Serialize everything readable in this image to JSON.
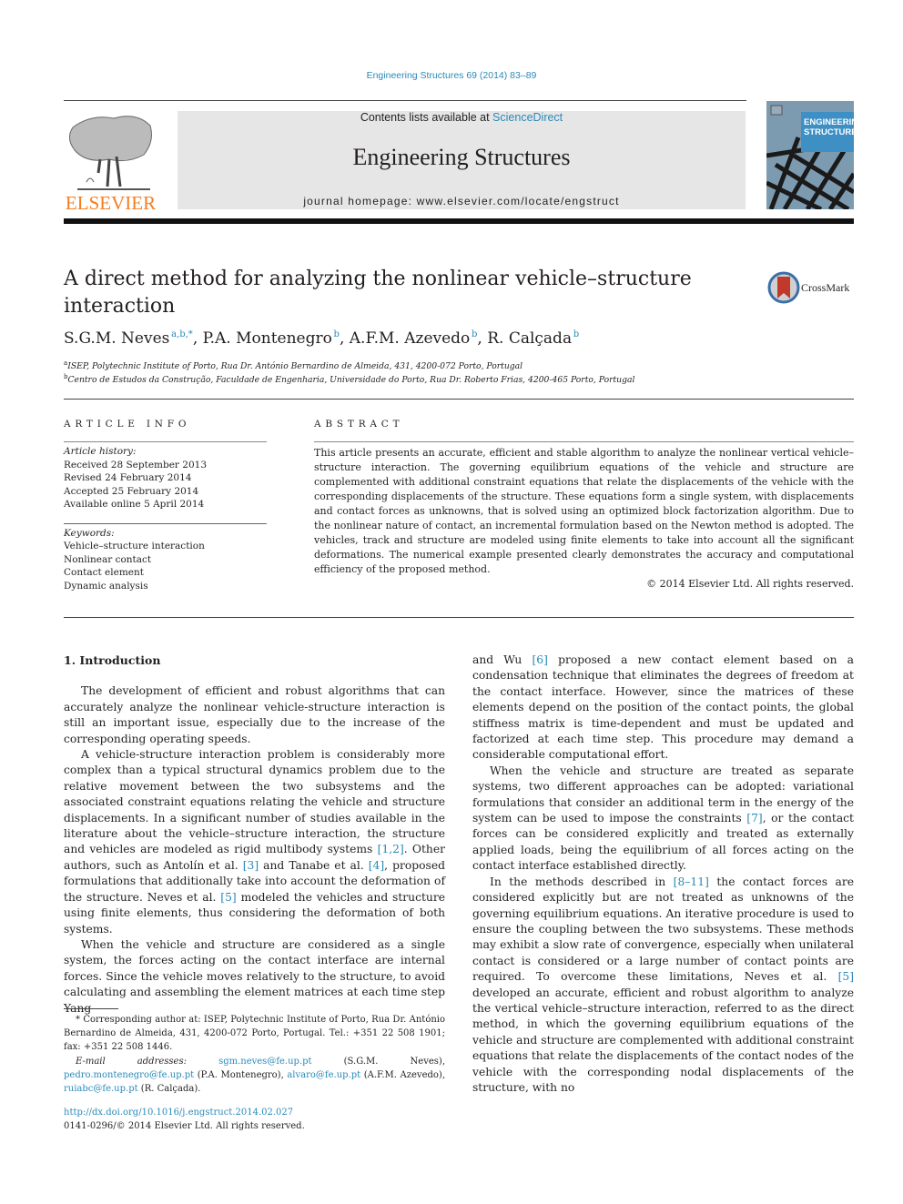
{
  "header": {
    "journal_ref": "Engineering Structures 69 (2014) 83–89",
    "contents_prefix": "Contents lists available at ",
    "contents_link": "ScienceDirect",
    "journal_name": "Engineering Structures",
    "homepage": "journal homepage: www.elsevier.com/locate/engstruct",
    "publisher": "ELSEVIER",
    "cover_title_line1": "ENGINEERING",
    "cover_title_line2": "STRUCTURES",
    "crossmark": "CrossMark"
  },
  "colors": {
    "link": "#2a8ab8",
    "elsevier_orange": "#f47d20",
    "masthead_bg": "#e6e6e6"
  },
  "article": {
    "title": "A direct method for analyzing the nonlinear vehicle–structure interaction",
    "authors": [
      {
        "name": "S.G.M. Neves",
        "sup": "a,b,*"
      },
      {
        "name": "P.A. Montenegro",
        "sup": "b"
      },
      {
        "name": "A.F.M. Azevedo",
        "sup": "b"
      },
      {
        "name": "R. Calçada",
        "sup": "b"
      }
    ],
    "affiliations": [
      {
        "mark": "a",
        "text": "ISEP, Polytechnic Institute of Porto, Rua Dr. António Bernardino de Almeida, 431, 4200-072 Porto, Portugal"
      },
      {
        "mark": "b",
        "text": "Centro de Estudos da Construção, Faculdade de Engenharia, Universidade do Porto, Rua Dr. Roberto Frias, 4200-465 Porto, Portugal"
      }
    ]
  },
  "article_info": {
    "heading": "ARTICLE INFO",
    "history_label": "Article history:",
    "history": [
      "Received 28 September 2013",
      "Revised 24 February 2014",
      "Accepted 25 February 2014",
      "Available online 5 April 2014"
    ],
    "keywords_label": "Keywords:",
    "keywords": [
      "Vehicle–structure interaction",
      "Nonlinear contact",
      "Contact element",
      "Dynamic analysis"
    ]
  },
  "abstract": {
    "heading": "ABSTRACT",
    "text": "This article presents an accurate, efficient and stable algorithm to analyze the nonlinear vertical vehicle–structure interaction. The governing equilibrium equations of the vehicle and structure are complemented with additional constraint equations that relate the displacements of the vehicle with the corresponding displacements of the structure. These equations form a single system, with displacements and contact forces as unknowns, that is solved using an optimized block factorization algorithm. Due to the nonlinear nature of contact, an incremental formulation based on the Newton method is adopted. The vehicles, track and structure are modeled using finite elements to take into account all the significant deformations. The numerical example presented clearly demonstrates the accuracy and computational efficiency of the proposed method.",
    "copyright": "© 2014 Elsevier Ltd. All rights reserved."
  },
  "body": {
    "section_title": "1. Introduction",
    "left": {
      "p1": "The development of efficient and robust algorithms that can accurately analyze the nonlinear vehicle-structure interaction is still an important issue, especially due to the increase of the corresponding operating speeds.",
      "p2_a": "A vehicle-structure interaction problem is considerably more complex than a typical structural dynamics problem due to the relative movement between the two subsystems and the associated constraint equations relating the vehicle and structure displacements. In a significant number of studies available in the literature about the vehicle–structure interaction, the structure and vehicles are modeled as rigid multibody systems ",
      "p2_ref1": "[1,2]",
      "p2_b": ". Other authors, such as Antolín et al. ",
      "p2_ref2": "[3]",
      "p2_c": " and Tanabe et al. ",
      "p2_ref3": "[4]",
      "p2_d": ", proposed formulations that additionally take into account the deformation of the structure. Neves et al. ",
      "p2_ref4": "[5]",
      "p2_e": " modeled the vehicles and structure using finite elements, thus considering the deformation of both systems.",
      "p3": "When the vehicle and structure are considered as a single system, the forces acting on the contact interface are internal forces. Since the vehicle moves relatively to the structure, to avoid calculating and assembling the element matrices at each time step Yang"
    },
    "right": {
      "p1_a": "and Wu ",
      "p1_ref": "[6]",
      "p1_b": " proposed a new contact element based on a condensation technique that eliminates the degrees of freedom at the contact interface. However, since the matrices of these elements depend on the position of the contact points, the global stiffness matrix is time-dependent and must be updated and factorized at each time step. This procedure may demand a considerable computational effort.",
      "p2_a": "When the vehicle and structure are treated as separate systems, two different approaches can be adopted: variational formulations that consider an additional term in the energy of the system can be used to impose the constraints ",
      "p2_ref": "[7]",
      "p2_b": ", or the contact forces can be considered explicitly and treated as externally applied loads, being the equilibrium of all forces acting on the contact interface established directly.",
      "p3_a": "In the methods described in ",
      "p3_ref1": "[8–11]",
      "p3_b": " the contact forces are considered explicitly but are not treated as unknowns of the governing equilibrium equations. An iterative procedure is used to ensure the coupling between the two subsystems. These methods may exhibit a slow rate of convergence, especially when unilateral contact is considered or a large number of contact points are required. To overcome these limitations, Neves et al. ",
      "p3_ref2": "[5]",
      "p3_c": " developed an accurate, efficient and robust algorithm to analyze the vertical vehicle–structure interaction, referred to as the direct method, in which the governing equilibrium equations of the vehicle and structure are complemented with additional constraint equations that relate the displacements of the contact nodes of the vehicle with the corresponding nodal displacements of the structure, with no"
    }
  },
  "footnote": {
    "corresponding": "* Corresponding author at: ISEP, Polytechnic Institute of Porto, Rua Dr. António Bernardino de Almeida, 431, 4200-072 Porto, Portugal. Tel.: +351 22 508 1901; fax: +351 22 508 1446.",
    "email_label": "E-mail addresses:",
    "emails": [
      {
        "email": "sgm.neves@fe.up.pt",
        "name": " (S.G.M. Neves), "
      },
      {
        "email": "pedro.montenegro@fe.up.pt",
        "name": " (P.A. Montenegro), "
      },
      {
        "email": "alvaro@fe.up.pt",
        "name": " (A.F.M. Azevedo), "
      },
      {
        "email": "ruiabc@fe.up.pt",
        "name": " (R. Calçada)."
      }
    ],
    "doi": "http://dx.doi.org/10.1016/j.engstruct.2014.02.027",
    "issn": "0141-0296/© 2014 Elsevier Ltd. All rights reserved."
  }
}
